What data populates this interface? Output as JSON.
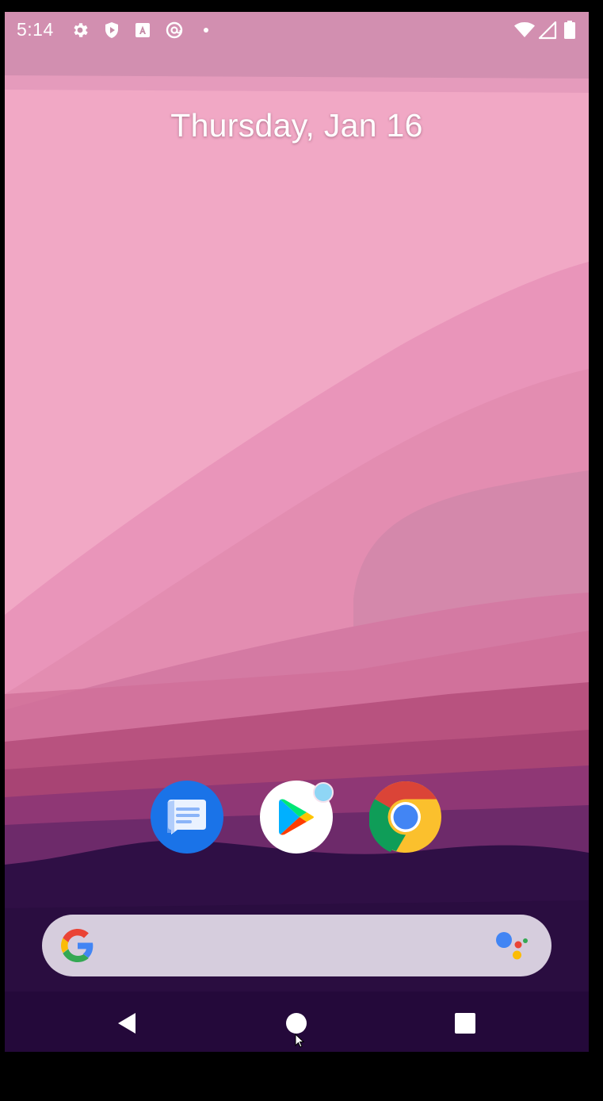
{
  "status_bar": {
    "time": "5:14",
    "left_icons": [
      "gear-icon",
      "shield-play-icon",
      "a-square-icon",
      "at-circle-icon",
      "dot-icon"
    ],
    "right_icons": [
      "wifi-icon",
      "cellular-signal-icon",
      "battery-icon"
    ]
  },
  "home": {
    "date": "Thursday, Jan 16"
  },
  "dock": {
    "apps": [
      {
        "name": "Messages",
        "icon": "messages-icon"
      },
      {
        "name": "Play Store",
        "icon": "play-store-icon",
        "has_notification_badge": true
      },
      {
        "name": "Chrome",
        "icon": "chrome-icon"
      }
    ]
  },
  "search_bar": {
    "left_icon": "google-g-icon",
    "right_icon": "google-assistant-icon"
  },
  "nav_bar": {
    "buttons": [
      "back-icon",
      "home-icon",
      "recents-icon"
    ]
  },
  "colors": {
    "wallpaper_top": "#d28fb0",
    "wallpaper_pink": "#f1a8c5",
    "wallpaper_mid": "#e58eb1",
    "wallpaper_deep": "#b8527f",
    "wallpaper_plum": "#6d2a6a",
    "wallpaper_night": "#2a0d40",
    "search_bar_bg": "#d6cddd"
  }
}
